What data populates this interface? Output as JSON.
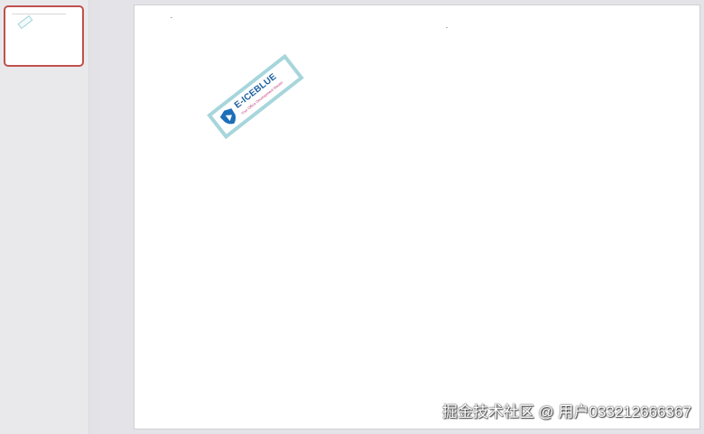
{
  "slides_pane": {
    "thumbnails": [
      {
        "selected": true
      }
    ]
  },
  "slide": {
    "logo": {
      "name": "E-ICEBLUE",
      "tagline": "Your Office Development Master",
      "icon": "shield-play-icon",
      "border_color": "#a6d6dc",
      "name_color": "#1a5fa0",
      "tagline_color": "#c23b7a"
    }
  },
  "watermark": {
    "text": "掘金技术社区 @ 用户033212666367"
  },
  "colors": {
    "selection_border": "#c0504d",
    "canvas_bg": "#e4e4e8",
    "slide_bg": "#ffffff"
  }
}
